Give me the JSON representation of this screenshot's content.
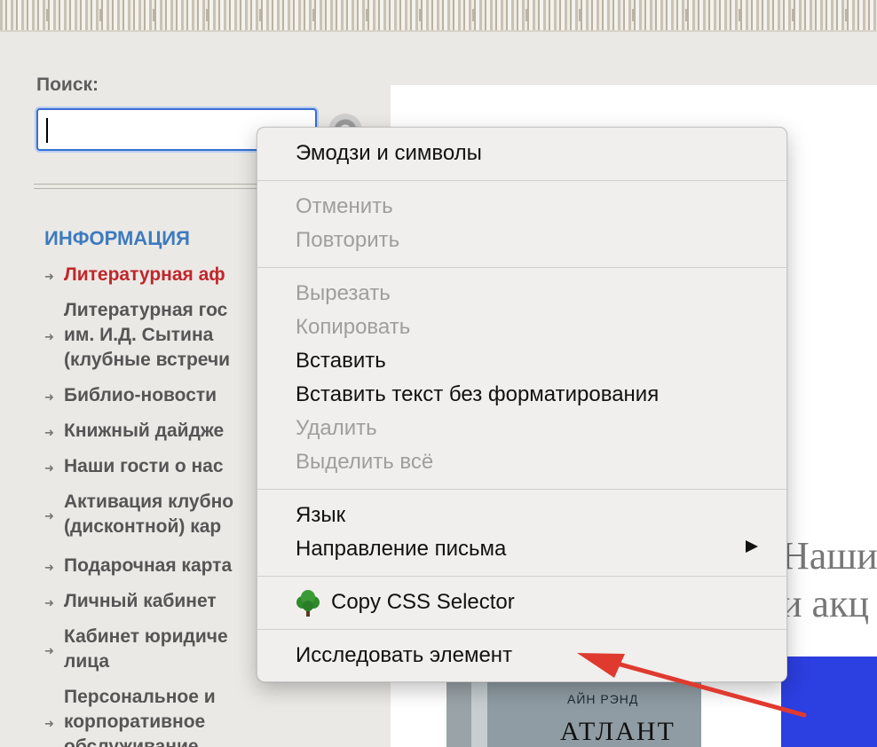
{
  "search": {
    "label": "Поиск:",
    "value": ""
  },
  "sidebar": {
    "title": "ИНФОРМАЦИЯ",
    "items": [
      {
        "label": "Литературная аф"
      },
      {
        "label": "Литературная гос\nим. И.Д. Сытина\n(клубные встречи"
      },
      {
        "label": "Библио-новости"
      },
      {
        "label": "Книжный дайдже"
      },
      {
        "label": "Наши гости о нас"
      },
      {
        "label": "Активация клубно\n(дисконтной) кар"
      },
      {
        "label": "Подарочная карта"
      },
      {
        "label": "Личный кабинет"
      },
      {
        "label": "Кабинет юридиче\nлица"
      },
      {
        "label": "Персональное и\nкорпоративное\nобслуживание"
      }
    ]
  },
  "background": {
    "heading_line1": "Наши",
    "heading_line2": "и акц",
    "book_author": "АЙН РЭНД",
    "book_title": "АТЛАНТ"
  },
  "context_menu": {
    "items": [
      {
        "label": "Эмодзи и символы",
        "enabled": true
      },
      {
        "label": "Отменить",
        "enabled": false
      },
      {
        "label": "Повторить",
        "enabled": false
      },
      {
        "label": "Вырезать",
        "enabled": false
      },
      {
        "label": "Копировать",
        "enabled": false
      },
      {
        "label": "Вставить",
        "enabled": true
      },
      {
        "label": "Вставить текст без форматирования",
        "enabled": true
      },
      {
        "label": "Удалить",
        "enabled": false
      },
      {
        "label": "Выделить всё",
        "enabled": false
      },
      {
        "label": "Язык",
        "enabled": true
      },
      {
        "label": "Направление письма",
        "enabled": true
      },
      {
        "label": "Copy CSS Selector",
        "enabled": true,
        "icon": "tree-icon"
      },
      {
        "label": "Исследовать элемент",
        "enabled": true
      }
    ]
  },
  "colors": {
    "accent_blue": "#3d7bbf",
    "active_red": "#c0262b",
    "annotation_arrow": "#e03a2f"
  }
}
